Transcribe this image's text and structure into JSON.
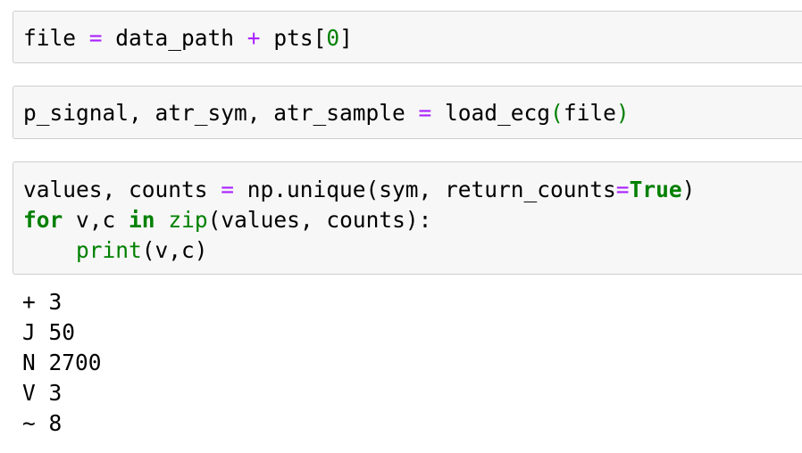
{
  "cells": [
    {
      "type": "code",
      "lines": [
        [
          {
            "kind": "text",
            "text": "file "
          },
          {
            "kind": "op",
            "text": "="
          },
          {
            "kind": "text",
            "text": " data_path "
          },
          {
            "kind": "op",
            "text": "+"
          },
          {
            "kind": "text",
            "text": " pts["
          },
          {
            "kind": "num",
            "text": "0"
          },
          {
            "kind": "text",
            "text": "]"
          }
        ]
      ]
    },
    {
      "type": "code",
      "lines": [
        [
          {
            "kind": "text",
            "text": "p_signal, atr_sym, atr_sample "
          },
          {
            "kind": "op",
            "text": "="
          },
          {
            "kind": "text",
            "text": " load_ecg"
          },
          {
            "kind": "num",
            "text": "("
          },
          {
            "kind": "text",
            "text": "file"
          },
          {
            "kind": "num",
            "text": ")"
          }
        ]
      ]
    },
    {
      "type": "code",
      "lines": [
        [
          {
            "kind": "text",
            "text": "values, counts "
          },
          {
            "kind": "op",
            "text": "="
          },
          {
            "kind": "text",
            "text": " np.unique(sym, return_counts"
          },
          {
            "kind": "op",
            "text": "="
          },
          {
            "kind": "const",
            "text": "True"
          },
          {
            "kind": "text",
            "text": ")"
          }
        ],
        [
          {
            "kind": "kw",
            "text": "for"
          },
          {
            "kind": "text",
            "text": " v,c "
          },
          {
            "kind": "kw",
            "text": "in"
          },
          {
            "kind": "text",
            "text": " "
          },
          {
            "kind": "builtin",
            "text": "zip"
          },
          {
            "kind": "text",
            "text": "(values, counts):"
          }
        ],
        [
          {
            "kind": "text",
            "text": "    "
          },
          {
            "kind": "builtin",
            "text": "print"
          },
          {
            "kind": "text",
            "text": "(v,c)"
          }
        ]
      ]
    }
  ],
  "output": {
    "lines": [
      "+ 3",
      "J 50",
      "N 2700",
      "V 3",
      "~ 8"
    ]
  }
}
